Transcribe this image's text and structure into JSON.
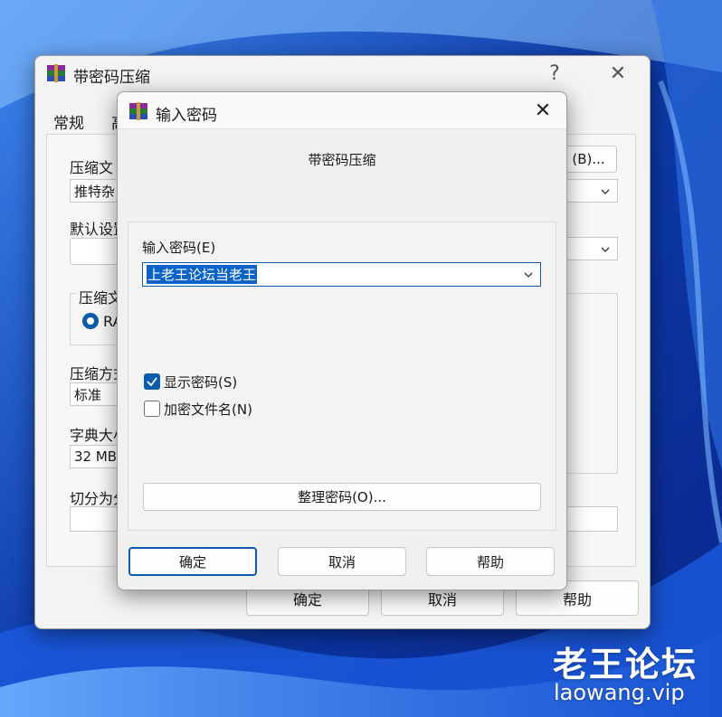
{
  "bg_dialog": {
    "title": "带密码压缩",
    "help_symbol": "?",
    "close_symbol": "✕",
    "tabs": [
      "常规",
      "高"
    ],
    "labels": {
      "archive_name": "压缩文",
      "default_settings": "默认设置",
      "archive_format": "压缩文",
      "format_option": "RA",
      "method": "压缩方式",
      "dictionary": "字典大小",
      "split": "切分为分"
    },
    "fields": {
      "archive_name": "推特杂",
      "method": "标准",
      "dictionary": "32 MB"
    },
    "browse_button": "(B)...",
    "buttons": {
      "ok": "确定",
      "cancel": "取消",
      "help": "帮助"
    }
  },
  "password_dialog": {
    "title": "输入密码",
    "close_symbol": "✕",
    "subtitle": "带密码压缩",
    "password_label": "输入密码(E)",
    "password_value": "上老王论坛当老王",
    "show_password": {
      "label": "显示密码(S)",
      "checked": true
    },
    "encrypt_names": {
      "label": "加密文件名(N)",
      "checked": false
    },
    "organize_button": "整理密码(O)...",
    "buttons": {
      "ok": "确定",
      "cancel": "取消",
      "help": "帮助"
    }
  },
  "watermark": {
    "line1": "老王论坛",
    "line2": "laowang.vip"
  },
  "colors": {
    "accent": "#0b5cad",
    "selection": "#0b63c9",
    "checkbox_checked": "#0b5cad"
  }
}
